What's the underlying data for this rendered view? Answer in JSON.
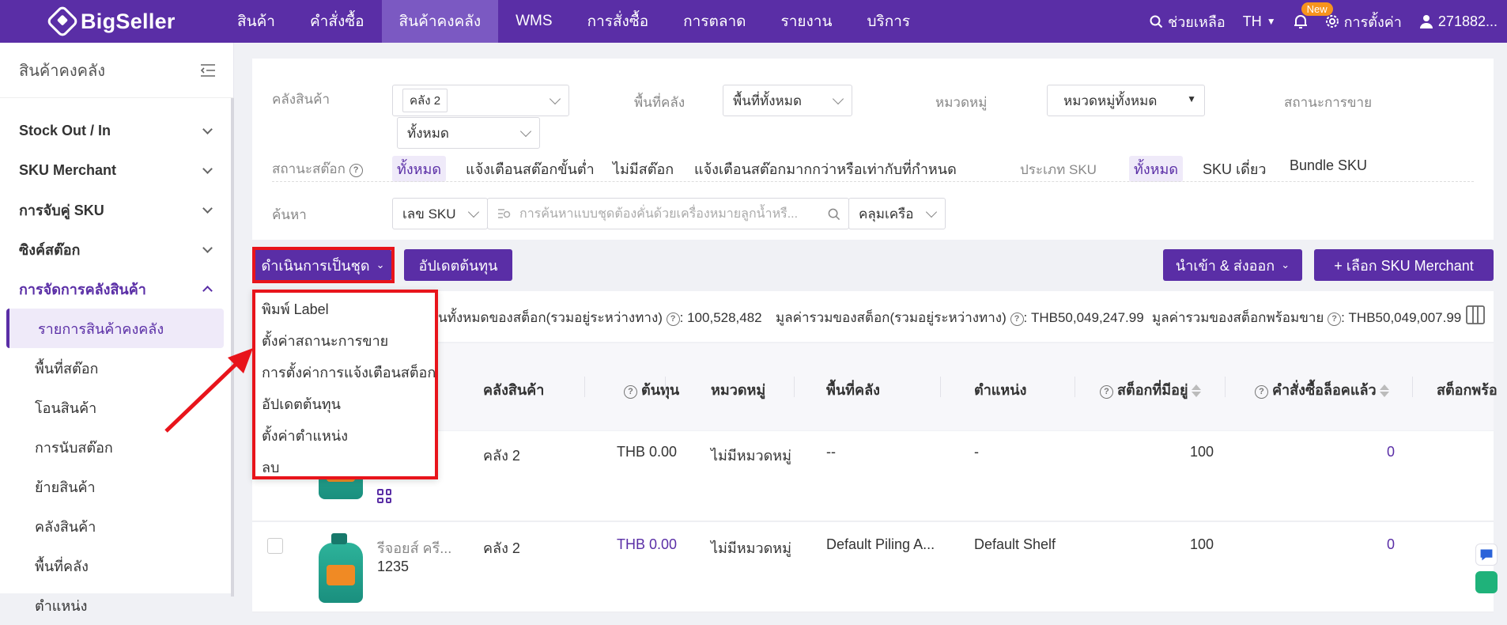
{
  "topbar": {
    "brand": "BigSeller",
    "nav": [
      "สินค้า",
      "คำสั่งซื้อ",
      "สินค้าคงคลัง",
      "WMS",
      "การสั่งซื้อ",
      "การตลาด",
      "รายงาน",
      "บริการ"
    ],
    "active_nav": "สินค้าคงคลัง",
    "help": "ช่วยเหลือ",
    "lang": "TH",
    "new_badge": "New",
    "settings": "การตั้งค่า",
    "user": "271882..."
  },
  "sidebar": {
    "title": "สินค้าคงคลัง",
    "groups": [
      "Stock Out / In",
      "SKU Merchant",
      "การจับคู่ SKU",
      "ซิงค์สต๊อก",
      "การจัดการคลังสินค้า"
    ],
    "items": [
      "รายการสินค้าคงคลัง",
      "พื้นที่สต๊อก",
      "โอนสินค้า",
      "การนับสต๊อก",
      "ย้ายสินค้า",
      "คลังสินค้า",
      "พื้นที่คลัง",
      "ตำแหน่ง"
    ]
  },
  "filters": {
    "warehouse_label": "คลังสินค้า",
    "warehouse_tag": "คลัง 2",
    "warehouse_all": "ทั้งหมด",
    "area_label": "พื้นที่คลัง",
    "area_value": "พื้นที่ทั้งหมด",
    "category_label": "หมวดหมู่",
    "category_value": "หมวดหมู่ทั้งหมด",
    "sale_status_label": "สถานะการขาย",
    "stock_status_label": "สถานะสต๊อก",
    "stock_opts": [
      "ทั้งหมด",
      "แจ้งเตือนสต๊อกขั้นต่ำ",
      "ไม่มีสต๊อก",
      "แจ้งเตือนสต๊อกมากกว่าหรือเท่ากับที่กำหนด"
    ],
    "sku_type_label": "ประเภท SKU",
    "sku_type_opts": [
      "ทั้งหมด",
      "SKU เดี่ยว",
      "Bundle SKU"
    ],
    "search_label": "ค้นหา",
    "search_field": "เลข SKU",
    "search_placeholder": "การค้นหาแบบชุดต้องคั่นด้วยเครื่องหมายลูกน้ำหรื...",
    "search_mode": "คลุมเครือ"
  },
  "toolbar": {
    "batch": "ดำเนินการเป็นชุด",
    "update_cost": "อัปเดตต้นทุน",
    "import_export": "นำเข้า & ส่งออก",
    "add_sku": "+ เลือก SKU Merchant"
  },
  "stats": {
    "total_label": "นทั้งหมดของสต็อก(รวมอยู่ระหว่างทาง)",
    "total_value": ": 100,528,482",
    "value_label": "มูลค่ารวมของสต็อก(รวมอยู่ระหว่างทาง)",
    "value_value": ": THB50,049,247.99",
    "sale_value_label": "มูลค่ารวมของสต็อกพร้อมขาย",
    "sale_value_value": ": THB50,049,007.99"
  },
  "table": {
    "headers": [
      "คลังสินค้า",
      "ต้นทุน",
      "หมวดหมู่",
      "พื้นที่คลัง",
      "ตำแหน่ง",
      "สต็อกที่มีอยู่",
      "คำสั่งซื้อล็อคแล้ว",
      "สต็อกพร้อ"
    ],
    "rows": [
      {
        "name": "",
        "code": "",
        "warehouse": "คลัง 2",
        "cost": "THB 0.00",
        "category": "ไม่มีหมวดหมู่",
        "area": "--",
        "location": "-",
        "stock": "100",
        "locked": "0"
      },
      {
        "name": "รีจอยส์ ครี...",
        "code": "1235",
        "warehouse": "คลัง 2",
        "cost": "THB 0.00",
        "category": "ไม่มีหมวดหมู่",
        "area": "Default Piling A...",
        "location": "Default Shelf",
        "stock": "100",
        "locked": "0"
      }
    ]
  },
  "dropdown": {
    "items": [
      "พิมพ์ Label",
      "ตั้งค่าสถานะการขาย",
      "การตั้งค่าการแจ้งเตือนสต็อก",
      "อัปเดตต้นทุน",
      "ตั้งค่าตำแหน่ง",
      "ลบ"
    ]
  },
  "colors": {
    "brand": "#5a2ea6",
    "highlight": "#e8141b"
  }
}
